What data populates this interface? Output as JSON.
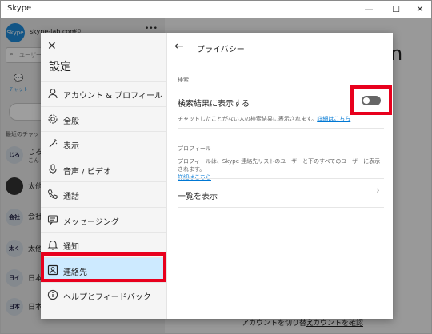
{
  "window": {
    "title": "Skype",
    "controls": [
      "—",
      "☐",
      "✕"
    ]
  },
  "background": {
    "account": "skype-lab.com",
    "account_suffix": "#0",
    "more": "•••",
    "search_placeholder": "ユーザー",
    "chat_tab": "チャット",
    "recent_label": "最近のチャット",
    "avatars": [
      "じろ",
      "",
      "会社",
      "太く",
      "日イ",
      "日本"
    ],
    "names": [
      "じろ",
      "太他",
      "会社",
      "太他",
      "日本",
      "日本"
    ],
    "preview": "こん",
    "big_letter": "n",
    "switch_account": "アカウントを切り替え",
    "verify_account": "アカウントを確認"
  },
  "modal": {
    "close_glyph": "✕",
    "title": "設定",
    "nav": [
      {
        "label": "アカウント & プロフィール",
        "icon": "person-icon"
      },
      {
        "label": "全般",
        "icon": "gear-icon"
      },
      {
        "label": "表示",
        "icon": "magic-wand-icon"
      },
      {
        "label": "音声 / ビデオ",
        "icon": "microphone-icon"
      },
      {
        "label": "通話",
        "icon": "phone-icon"
      },
      {
        "label": "メッセージング",
        "icon": "message-icon"
      },
      {
        "label": "通知",
        "icon": "bell-icon"
      },
      {
        "label": "連絡先",
        "icon": "contacts-icon",
        "selected": true
      },
      {
        "label": "ヘルプとフィードバック",
        "icon": "info-icon"
      }
    ],
    "pane": {
      "back_glyph": "←",
      "title": "プライバシー",
      "search_section": "検索",
      "search_setting": "検索結果に表示する",
      "search_toggle_on": false,
      "search_desc": "チャットしたことがない人の検索結果に表示されます。",
      "search_link": "詳細はこちら",
      "profile_section": "プロフィール",
      "profile_desc": "プロフィールは、Skype 連絡先リストのユーザーと下のすべてのユーザーに表示されます。",
      "profile_link": "詳細はこちら",
      "view_list": "一覧を表示",
      "chevron": "›"
    }
  }
}
